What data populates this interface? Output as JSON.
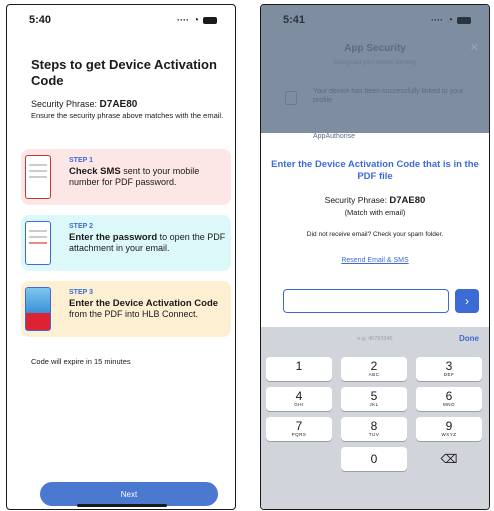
{
  "left": {
    "time": "5:40",
    "title": "Steps to get Device Activation Code",
    "phrase_label": "Security Phrase:",
    "phrase_value": "D7AE80",
    "ensure_text": "Ensure the security phrase above matches with the email.",
    "steps": [
      {
        "num": "STEP 1",
        "bold": "Check SMS",
        "rest": " sent to your mobile number for PDF password."
      },
      {
        "num": "STEP 2",
        "bold": "Enter the password",
        "rest": " to open the PDF attachment in your email."
      },
      {
        "num": "STEP 3",
        "bold": "Enter the Device Activation Code",
        "rest": " from the PDF into HLB Connect."
      }
    ],
    "expire": "Code will expire in 15 minutes",
    "next_label": "Next"
  },
  "right": {
    "time": "5:41",
    "bg_title": "App Security",
    "bg_subtitle": "Safeguard your mobile banking",
    "bg_close": "✕",
    "bg_message": "Your device has been successfully linked to your profile",
    "bg_authorities": "AppAuthorise",
    "heading": "Enter the Device Activation Code that is in the PDF file",
    "phrase_label": "Security Phrase:",
    "phrase_value": "D7AE80",
    "match_text": "(Match with email)",
    "not_received": "Did not receive email? Check your spam folder.",
    "resend": "Resend Email & SMS",
    "code_value": "",
    "go_icon": "›",
    "keyboard": {
      "hint": "e.g. 45783345",
      "done": "Done",
      "keys": [
        {
          "d": "1",
          "s": ""
        },
        {
          "d": "2",
          "s": "ABC"
        },
        {
          "d": "3",
          "s": "DEF"
        },
        {
          "d": "4",
          "s": "GHI"
        },
        {
          "d": "5",
          "s": "JKL"
        },
        {
          "d": "6",
          "s": "MNO"
        },
        {
          "d": "7",
          "s": "PQRS"
        },
        {
          "d": "8",
          "s": "TUV"
        },
        {
          "d": "9",
          "s": "WXYZ"
        },
        {
          "d": "0",
          "s": ""
        }
      ],
      "delete_icon": "⌫"
    }
  },
  "colors": {
    "accent": "#3d6bd6",
    "button": "#4a79cf",
    "step1": "#fde6e6",
    "step2": "#dcf8f8",
    "step3": "#fdefd2"
  }
}
